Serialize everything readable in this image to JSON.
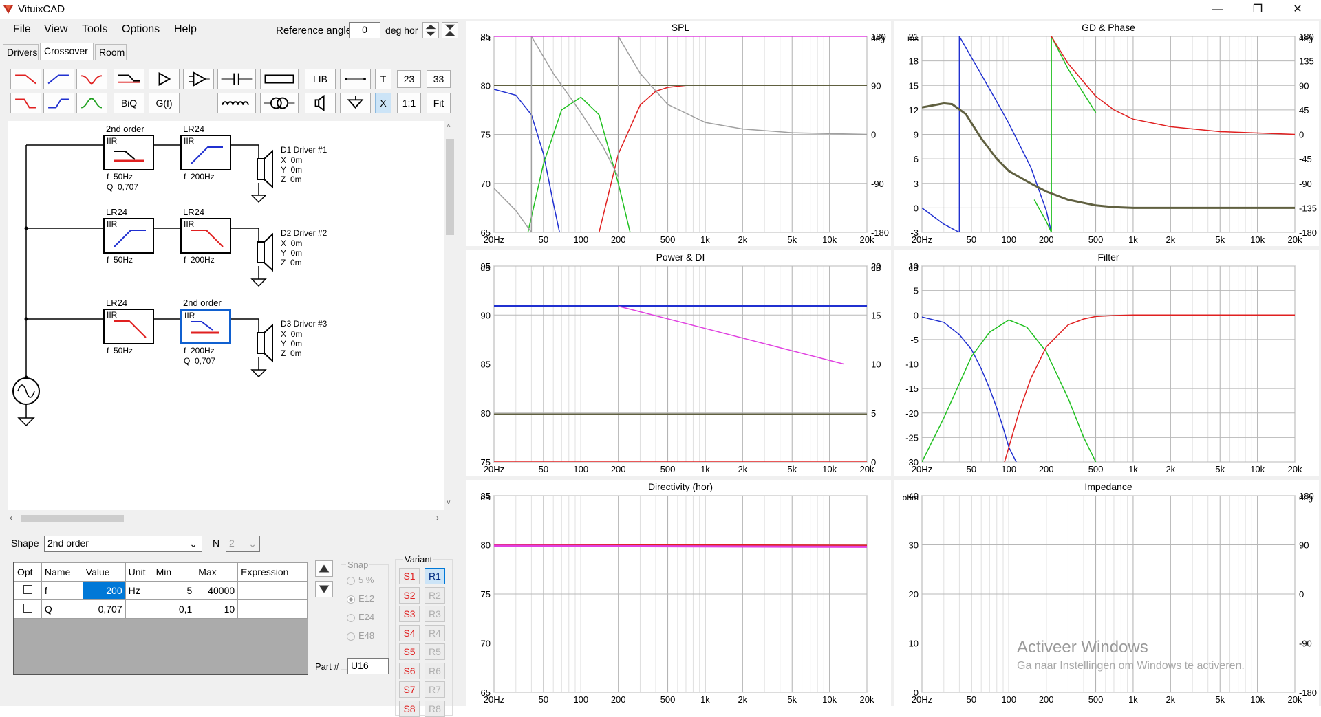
{
  "window": {
    "title": "VituixCAD",
    "min_glyph": "—",
    "max_glyph": "❐",
    "close_glyph": "✕"
  },
  "menu": [
    "File",
    "View",
    "Tools",
    "Options",
    "Help"
  ],
  "reference": {
    "label": "Reference angle",
    "value": "0",
    "unit": "deg hor"
  },
  "tabs": [
    "Drivers",
    "Crossover",
    "Room"
  ],
  "toolbar": {
    "lib": "LIB",
    "t": "T",
    "n23": "23",
    "n33": "33",
    "biq": "BiQ",
    "gf": "G(f)",
    "x": "X",
    "one": "1:1",
    "fit": "Fit"
  },
  "schematic": {
    "blocks": [
      {
        "title": "2nd order",
        "type": "IIR",
        "f": "f  50Hz",
        "q": "Q  0,707"
      },
      {
        "title": "LR24",
        "type": "IIR",
        "f": "f  200Hz",
        "q": ""
      },
      {
        "title": "LR24",
        "type": "IIR",
        "f": "f  50Hz",
        "q": ""
      },
      {
        "title": "LR24",
        "type": "IIR",
        "f": "f  200Hz",
        "q": ""
      },
      {
        "title": "LR24",
        "type": "IIR",
        "f": "f  50Hz",
        "q": ""
      },
      {
        "title": "2nd order",
        "type": "IIR",
        "f": "f  200Hz",
        "q": "Q  0,707"
      }
    ],
    "drivers": [
      {
        "name": "D1 Driver #1",
        "x": "X  0m",
        "y": "Y  0m",
        "z": "Z  0m"
      },
      {
        "name": "D2 Driver #2",
        "x": "X  0m",
        "y": "Y  0m",
        "z": "Z  0m"
      },
      {
        "name": "D3 Driver #3",
        "x": "X  0m",
        "y": "Y  0m",
        "z": "Z  0m"
      }
    ]
  },
  "shape": {
    "label": "Shape",
    "value": "2nd order",
    "n_label": "N",
    "n_value": "2"
  },
  "params": {
    "headers": [
      "Opt",
      "Name",
      "Value",
      "Unit",
      "Min",
      "Max",
      "Expression"
    ],
    "rows": [
      {
        "name": "f",
        "value": "200",
        "unit": "Hz",
        "min": "5",
        "max": "40000",
        "expr": ""
      },
      {
        "name": "Q",
        "value": "0,707",
        "unit": "",
        "min": "0,1",
        "max": "10",
        "expr": ""
      }
    ]
  },
  "snap": {
    "label": "Snap",
    "options": [
      "5 %",
      "E12",
      "E24",
      "E48"
    ],
    "selected": "E12"
  },
  "part": {
    "label": "Part #",
    "value": "U16"
  },
  "variant": {
    "label": "Variant",
    "s": [
      "S1",
      "S2",
      "S3",
      "S4",
      "S5",
      "S6",
      "S7",
      "S8"
    ],
    "r": [
      "R1",
      "R2",
      "R3",
      "R4",
      "R5",
      "R6",
      "R7",
      "R8"
    ]
  },
  "xticks": [
    "20Hz",
    "50",
    "100",
    "200",
    "500",
    "1k",
    "2k",
    "5k",
    "10k",
    "20k"
  ],
  "watermark": {
    "line1": "Activeer Windows",
    "line2": "Ga naar Instellingen om Windows te activeren."
  },
  "colors": {
    "red": "#e02020",
    "green": "#20c020",
    "blue": "#2030d0",
    "gray": "#a0a0a0",
    "olive": "#606040",
    "magenta": "#e040e0"
  },
  "chart_data": [
    {
      "type": "line",
      "title": "SPL",
      "ylabel": "dB",
      "y2label": "deg",
      "ylim": [
        65,
        85
      ],
      "y2lim": [
        -180,
        180
      ],
      "yticks": [
        "85",
        "80",
        "75",
        "70",
        "65"
      ],
      "y2ticks": [
        "180",
        "90",
        "0",
        "-90",
        "-180"
      ],
      "series": [
        {
          "color": "blue",
          "axis": "y",
          "x": [
            20,
            30,
            40,
            50,
            60,
            70
          ],
          "y": [
            79.6,
            79,
            77,
            73,
            68,
            64
          ]
        },
        {
          "color": "green",
          "axis": "y",
          "x": [
            36,
            50,
            70,
            100,
            140,
            200,
            260
          ],
          "y": [
            64,
            72,
            77.5,
            78.8,
            77,
            70,
            64
          ]
        },
        {
          "color": "red",
          "axis": "y",
          "x": [
            140,
            200,
            300,
            400,
            500,
            700,
            1000,
            20000
          ],
          "y": [
            65,
            73,
            78,
            79.4,
            79.8,
            80,
            80,
            80
          ]
        },
        {
          "color": "olive",
          "axis": "y",
          "x": [
            20,
            20000
          ],
          "y": [
            80,
            80
          ]
        },
        {
          "color": "gray",
          "axis": "y2",
          "x": [
            20,
            30,
            40,
            40,
            60,
            100,
            150,
            200,
            200,
            300,
            500,
            1000,
            2000,
            5000,
            20000
          ],
          "y": [
            -99,
            -140,
            -180,
            180,
            112,
            40,
            -22,
            -78,
            180,
            112,
            55,
            22,
            10,
            3,
            0
          ]
        },
        {
          "color": "magenta",
          "axis": "y",
          "x": [
            20,
            20000
          ],
          "y": [
            85,
            85
          ]
        }
      ]
    },
    {
      "type": "line",
      "title": "GD & Phase",
      "ylabel": "ms",
      "y2label": "deg",
      "ylim": [
        -3,
        21
      ],
      "y2lim": [
        -180,
        180
      ],
      "yticks": [
        "21",
        "18",
        "15",
        "12",
        "9",
        "6",
        "3",
        "0",
        "-3"
      ],
      "y2ticks": [
        "180",
        "135",
        "90",
        "45",
        "0",
        "-45",
        "-90",
        "-135",
        "-180"
      ],
      "series": [
        {
          "color": "blue",
          "axis": "y2",
          "x": [
            20,
            30,
            40,
            40,
            60,
            80,
            100,
            150,
            200,
            220
          ],
          "y": [
            -135,
            -165,
            -180,
            180,
            110,
            60,
            20,
            -60,
            -140,
            -180
          ]
        },
        {
          "color": "green",
          "axis": "y2",
          "x": [
            160,
            200,
            220,
            220,
            300,
            500
          ],
          "y": [
            -120,
            -160,
            -180,
            180,
            120,
            40
          ]
        },
        {
          "color": "red",
          "axis": "y2",
          "x": [
            220,
            300,
            500,
            700,
            1000,
            2000,
            5000,
            20000
          ],
          "y": [
            180,
            130,
            70,
            45,
            28,
            14,
            5,
            0
          ]
        },
        {
          "color": "olive",
          "axis": "y",
          "x": [
            20,
            30,
            35,
            45,
            60,
            80,
            100,
            150,
            200,
            300,
            500,
            700,
            1000,
            2000,
            20000
          ],
          "y": [
            12.3,
            12.8,
            12.7,
            11.5,
            8.5,
            6,
            4.5,
            3,
            2,
            1,
            0.3,
            0.1,
            0,
            0,
            0
          ]
        }
      ]
    },
    {
      "type": "line",
      "title": "Power & DI",
      "ylabel": "dB",
      "y2label": "dB",
      "ylim": [
        75,
        95
      ],
      "y2lim": [
        0,
        20
      ],
      "yticks": [
        "95",
        "90",
        "85",
        "80",
        "75"
      ],
      "y2ticks": [
        "20",
        "15",
        "10",
        "5",
        "0"
      ],
      "series": [
        {
          "color": "blue",
          "axis": "y",
          "x": [
            20,
            20000
          ],
          "y": [
            90.9,
            90.9
          ]
        },
        {
          "color": "magenta",
          "axis": "y",
          "x": [
            200,
            13000
          ],
          "y": [
            90.9,
            85
          ]
        },
        {
          "color": "olive",
          "axis": "y",
          "x": [
            20,
            20000
          ],
          "y": [
            79.9,
            79.9
          ]
        },
        {
          "color": "red",
          "axis": "y2",
          "x": [
            20,
            20000
          ],
          "y": [
            0,
            0
          ]
        }
      ]
    },
    {
      "type": "line",
      "title": "Filter",
      "ylabel": "dB",
      "ylim": [
        -30,
        10
      ],
      "yticks": [
        "10",
        "5",
        "0",
        "-5",
        "-10",
        "-15",
        "-20",
        "-25",
        "-30"
      ],
      "series": [
        {
          "color": "blue",
          "axis": "y",
          "x": [
            20,
            30,
            40,
            50,
            60,
            70,
            80,
            90,
            100,
            120
          ],
          "y": [
            -0.4,
            -1.5,
            -4,
            -7,
            -11,
            -15,
            -19,
            -23,
            -27,
            -31
          ]
        },
        {
          "color": "green",
          "axis": "y",
          "x": [
            20,
            30,
            40,
            50,
            70,
            100,
            140,
            200,
            300,
            400,
            500
          ],
          "y": [
            -30,
            -21,
            -14,
            -8.5,
            -3.5,
            -1,
            -2.5,
            -7.5,
            -17,
            -25,
            -30
          ]
        },
        {
          "color": "red",
          "axis": "y",
          "x": [
            90,
            100,
            120,
            150,
            200,
            300,
            400,
            500,
            700,
            1000,
            20000
          ],
          "y": [
            -31,
            -27,
            -20,
            -13,
            -6.5,
            -2,
            -0.8,
            -0.3,
            -0.1,
            0,
            0
          ]
        }
      ]
    },
    {
      "type": "line",
      "title": "Directivity (hor)",
      "ylabel": "dB",
      "ylim": [
        65,
        85
      ],
      "yticks": [
        "85",
        "80",
        "75",
        "70",
        "65"
      ],
      "series": [
        {
          "color": "red",
          "axis": "y",
          "x": [
            20,
            20000
          ],
          "y": [
            80,
            79.9
          ]
        },
        {
          "color": "magenta",
          "axis": "y",
          "x": [
            20,
            20000
          ],
          "y": [
            79.9,
            79.8
          ]
        }
      ]
    },
    {
      "type": "line",
      "title": "Impedance",
      "ylabel": "ohm",
      "y2label": "deg",
      "ylim": [
        0,
        40
      ],
      "y2lim": [
        -180,
        180
      ],
      "yticks": [
        "40",
        "30",
        "20",
        "10",
        "0"
      ],
      "y2ticks": [
        "180",
        "90",
        "0",
        "-90",
        "-180"
      ],
      "series": []
    }
  ]
}
